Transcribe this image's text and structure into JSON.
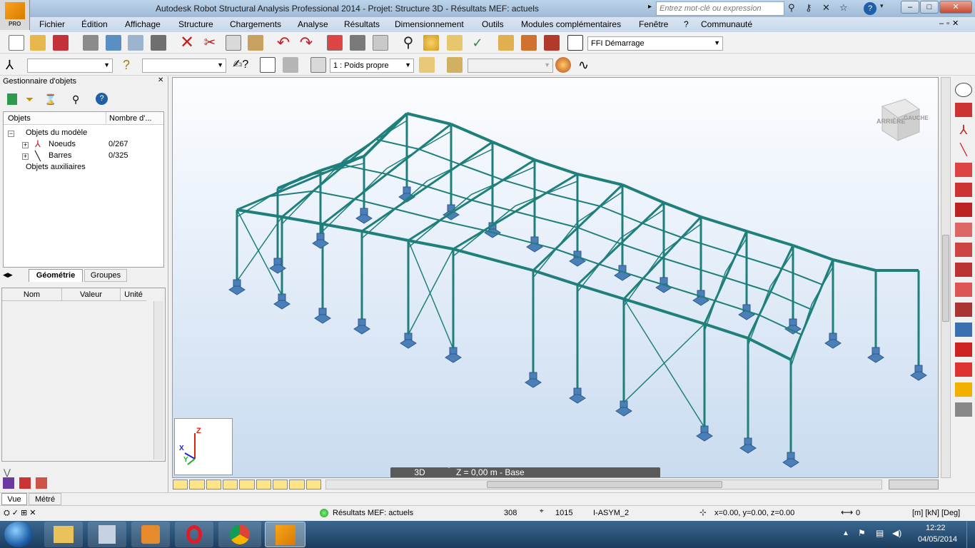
{
  "window": {
    "title": "Autodesk Robot Structural Analysis Professional 2014 - Projet: Structure 3D - Résultats MEF: actuels",
    "logo_badge": "PRO",
    "search_placeholder": "Entrez mot-clé ou expression"
  },
  "menu": [
    "Fichier",
    "Édition",
    "Affichage",
    "Structure",
    "Chargements",
    "Analyse",
    "Résultats",
    "Dimensionnement",
    "Outils",
    "Modules complémentaires",
    "Fenêtre",
    "?",
    "Communauté"
  ],
  "toolbar": {
    "layout_combo": "Démarrage",
    "load_case_combo": "1 : Poids propre"
  },
  "object_manager": {
    "title": "Gestionnaire d'objets",
    "col_objects": "Objets",
    "col_count": "Nombre d'...",
    "root": "Objets du modèle",
    "items": [
      {
        "label": "Noeuds",
        "count": "0/267"
      },
      {
        "label": "Barres",
        "count": "0/325"
      }
    ],
    "aux": "Objets auxiliaires",
    "tabs": [
      "Géométrie",
      "Groupes"
    ],
    "prop_cols": [
      "Nom",
      "Valeur",
      "Unité"
    ]
  },
  "viewport": {
    "view_label": "3D",
    "plane_label": "Z = 0,00 m - Base",
    "cube_back": "ARRIÈRE",
    "cube_left": "GAUCHE",
    "axis_z": "Z",
    "axis_x": "X",
    "axis_y": "Y"
  },
  "bottom_tabs": [
    "Vue",
    "Métré"
  ],
  "status": {
    "results": "Résultats MEF: actuels",
    "nodes": "308",
    "bars": "1015",
    "section": "I-ASYM_2",
    "coords": "x=0.00, y=0.00, z=0.00",
    "value": "0",
    "units": "[m] [kN] [Deg]"
  },
  "taskbar": {
    "time": "12:22",
    "date": "04/05/2014"
  },
  "colors": {
    "structure": "#1f7f7a",
    "support": "#4a7fb8",
    "accent": "#f39c12"
  }
}
